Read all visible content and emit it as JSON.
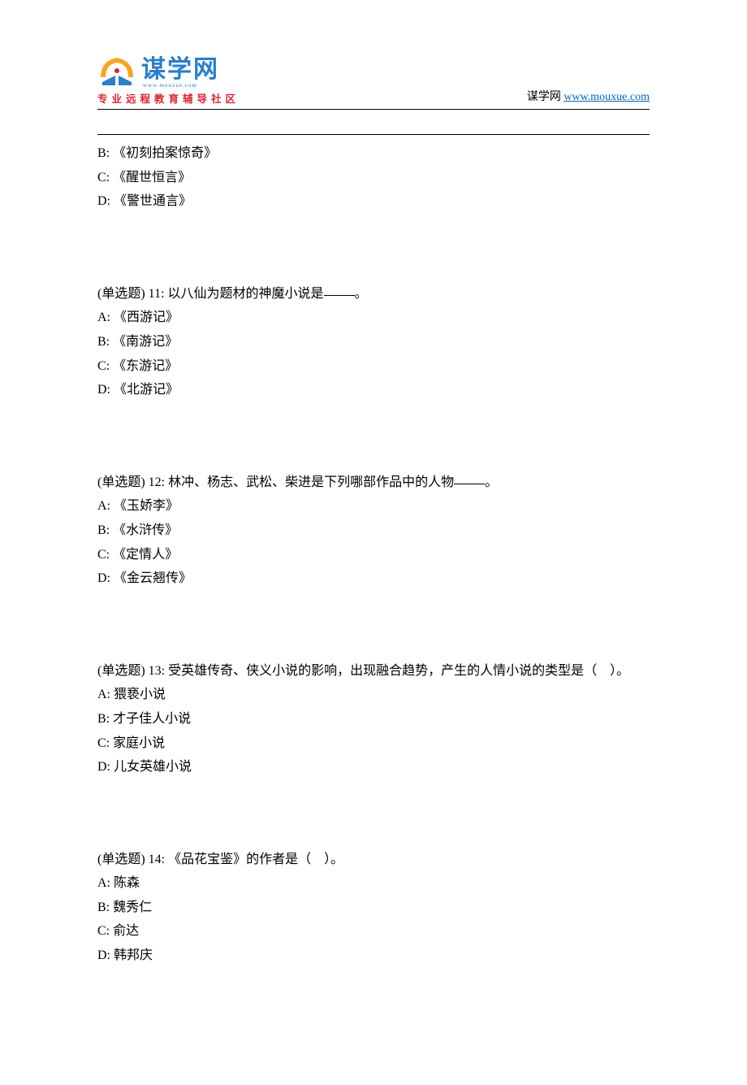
{
  "header": {
    "logo_text": "谋学网",
    "logo_sub": "www.mouxue.com",
    "tagline": "专业远程教育辅导社区",
    "site_label": "谋学网",
    "site_url": "www.mouxue.com"
  },
  "partial_question": {
    "options": [
      {
        "label": "B:",
        "text": "《初刻拍案惊奇》"
      },
      {
        "label": "C:",
        "text": "《醒世恒言》"
      },
      {
        "label": "D:",
        "text": "《警世通言》"
      }
    ]
  },
  "questions": [
    {
      "type_label": "(单选题)",
      "number": "11:",
      "stem_pre": "以八仙为题材的神魔小说是",
      "stem_post": "。",
      "has_blank": true,
      "options": [
        {
          "label": "A:",
          "text": "《西游记》"
        },
        {
          "label": "B:",
          "text": "《南游记》"
        },
        {
          "label": "C:",
          "text": "《东游记》"
        },
        {
          "label": "D:",
          "text": "《北游记》"
        }
      ]
    },
    {
      "type_label": "(单选题)",
      "number": "12:",
      "stem_pre": "林冲、杨志、武松、柴进是下列哪部作品中的人物",
      "stem_post": "。",
      "has_blank": true,
      "options": [
        {
          "label": "A:",
          "text": "《玉娇李》"
        },
        {
          "label": "B:",
          "text": "《水浒传》"
        },
        {
          "label": "C:",
          "text": "《定情人》"
        },
        {
          "label": "D:",
          "text": "《金云翘传》"
        }
      ]
    },
    {
      "type_label": "(单选题)",
      "number": "13:",
      "stem_pre": "受英雄传奇、侠义小说的影响，出现融合趋势，产生的人情小说的类型是（　）。",
      "stem_post": "",
      "has_blank": false,
      "options": [
        {
          "label": "A:",
          "text": "猥亵小说"
        },
        {
          "label": "B:",
          "text": "才子佳人小说"
        },
        {
          "label": "C:",
          "text": "家庭小说"
        },
        {
          "label": "D:",
          "text": "儿女英雄小说"
        }
      ]
    },
    {
      "type_label": "(单选题)",
      "number": "14:",
      "stem_pre": "《品花宝鉴》的作者是（　）。",
      "stem_post": "",
      "has_blank": false,
      "options": [
        {
          "label": "A:",
          "text": "陈森"
        },
        {
          "label": "B:",
          "text": "魏秀仁"
        },
        {
          "label": "C:",
          "text": "俞达"
        },
        {
          "label": "D:",
          "text": "韩邦庆"
        }
      ]
    }
  ]
}
